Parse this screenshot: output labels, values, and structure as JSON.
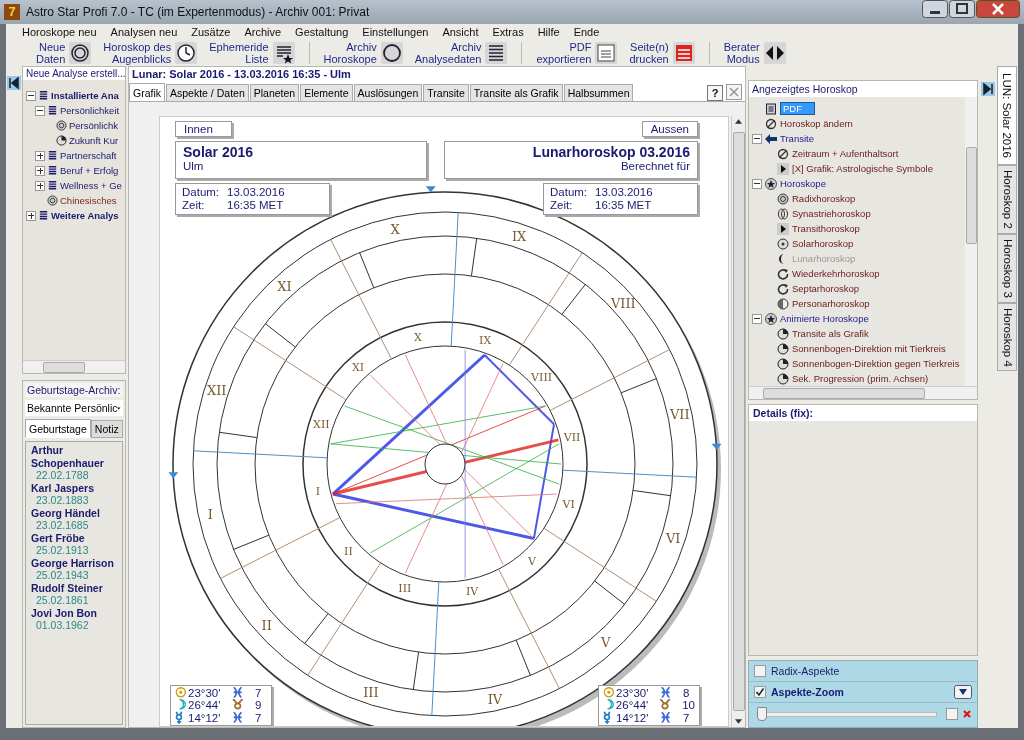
{
  "window": {
    "icon_label": "7",
    "title": "Astro Star Profi 7.0 - TC (im Expertenmodus) - Archiv 001: Privat"
  },
  "menu": [
    "Horoskope neu",
    "Analysen neu",
    "Zusätze",
    "Archive",
    "Gestaltung",
    "Einstellungen",
    "Ansicht",
    "Extras",
    "Hilfe",
    "Ende"
  ],
  "toolbar": [
    [
      {
        "lines": [
          "Neue",
          "Daten"
        ],
        "kind": "rings"
      },
      {
        "lines": [
          "Horoskop des",
          "Augenblicks"
        ],
        "kind": "clock"
      },
      {
        "lines": [
          "Ephemeride",
          "Liste"
        ],
        "kind": "list-star"
      }
    ],
    [
      {
        "lines": [
          "Archiv",
          "Horoskope"
        ],
        "kind": "circle"
      },
      {
        "lines": [
          "Archiv",
          "Analysedaten"
        ],
        "kind": "list"
      }
    ],
    [
      {
        "lines": [
          "PDF",
          "exportieren"
        ],
        "kind": "pdf"
      },
      {
        "lines": [
          "Seite(n)",
          "drucken"
        ],
        "kind": "printer"
      }
    ],
    [
      {
        "lines": [
          "Berater",
          "Modus"
        ],
        "kind": "arrows"
      }
    ]
  ],
  "left_panel": {
    "header": "Neue Analyse erstell...",
    "tree": [
      {
        "label": "Installierte Ana",
        "kind": "stack",
        "expanded": true,
        "children": [
          {
            "label": "Persönlichkeit",
            "kind": "stack",
            "expanded": true,
            "children": [
              {
                "label": "Persönlichk",
                "kind": "wheel"
              },
              {
                "label": "Zukunft Kur",
                "kind": "clock"
              }
            ]
          },
          {
            "label": "Partnerschaft",
            "kind": "stack",
            "expanded": false
          },
          {
            "label": "Beruf + Erfolg",
            "kind": "stack",
            "expanded": false
          },
          {
            "label": "Wellness + Ge",
            "kind": "stack",
            "expanded": false
          },
          {
            "label": "Chinesisches",
            "kind": "chinese"
          }
        ]
      },
      {
        "label": "Weitere Analys",
        "kind": "stack",
        "expanded": false
      }
    ],
    "birthdays": {
      "label": "Geburtstage-Archiv:",
      "dropdown": "Bekannte Persönlic",
      "tabs": [
        {
          "label": "Geburtstage",
          "selected": true
        },
        {
          "label": "Notiz",
          "selected": false
        }
      ],
      "entries": [
        {
          "name": "Arthur Schopenhauer",
          "date": "22.02.1788"
        },
        {
          "name": "Karl Jaspers",
          "date": "23.02.1883"
        },
        {
          "name": "Georg Händel",
          "date": "23.02.1685"
        },
        {
          "name": "Gert Fröbe",
          "date": "25.02.1913"
        },
        {
          "name": "George Harrison",
          "date": "25.02.1943"
        },
        {
          "name": "Rudolf Steiner",
          "date": "25.02.1861"
        },
        {
          "name": "Jovi Jon Bon",
          "date": "01.03.1962"
        }
      ]
    }
  },
  "main": {
    "header": "Lunar: Solar  2016 - 13.03.2016 16:35 - Ulm",
    "tabs": [
      {
        "label": "Grafik",
        "selected": true
      },
      {
        "label": "Aspekte / Daten",
        "selected": false
      },
      {
        "label": "Planeten",
        "selected": false
      },
      {
        "label": "Elemente",
        "selected": false
      },
      {
        "label": "Auslösungen",
        "selected": false
      },
      {
        "label": "Transite",
        "selected": false
      },
      {
        "label": "Transite als Grafik",
        "selected": false
      },
      {
        "label": "Halbsummen",
        "selected": false
      }
    ],
    "help_button": "?",
    "chart": {
      "inner_label": "Innen",
      "outer_label": "Aussen",
      "left_title": "Solar  2016",
      "left_subtitle": "Ulm",
      "right_title": "Lunarhoroskop 03.2016",
      "right_subtitle": "Berechnet für",
      "left_details": [
        {
          "label": "Datum:",
          "value": "13.03.2016"
        },
        {
          "label": "Zeit:",
          "value": "16:35  MET"
        }
      ],
      "right_details": [
        {
          "label": "Datum:",
          "value": "13.03.2016"
        },
        {
          "label": "Zeit:",
          "value": "16:35  MET"
        }
      ],
      "outer_houses": [
        "I",
        "II",
        "III",
        "IV",
        "V",
        "VI",
        "VII",
        "VIII",
        "IX",
        "X",
        "XI",
        "XII"
      ],
      "inner_houses": [
        "I",
        "II",
        "III",
        "IV",
        "V",
        "VI",
        "VII",
        "VIII",
        "IX",
        "X",
        "XI",
        "XII"
      ],
      "left_positions": [
        {
          "planet": {
            "glyph": "☉",
            "color": "#d4a017"
          },
          "position": "23°30'",
          "sign": {
            "glyph": "♓",
            "color": "#3a6ad4"
          },
          "house": "7"
        },
        {
          "planet": {
            "glyph": "☽",
            "color": "#20b0c0"
          },
          "position": "26°44'",
          "sign": {
            "glyph": "♉",
            "color": "#a07030"
          },
          "house": "9"
        },
        {
          "planet": {
            "glyph": "☿",
            "color": "#2080c0"
          },
          "position": "14°12'",
          "sign": {
            "glyph": "♓",
            "color": "#3a6ad4"
          },
          "house": "7"
        }
      ],
      "right_positions": [
        {
          "planet": {
            "glyph": "☉",
            "color": "#d4a017"
          },
          "position": "23°30'",
          "sign": {
            "glyph": "♓",
            "color": "#3a6ad4"
          },
          "house": "8"
        },
        {
          "planet": {
            "glyph": "☽",
            "color": "#20b0c0"
          },
          "position": "26°44'",
          "sign": {
            "glyph": "♉",
            "color": "#a07030"
          },
          "house": "10"
        },
        {
          "planet": {
            "glyph": "☿",
            "color": "#2080c0"
          },
          "position": "14°12'",
          "sign": {
            "glyph": "♓",
            "color": "#3a6ad4"
          },
          "house": "7"
        }
      ]
    }
  },
  "right_panel": {
    "header": "Angezeigtes Horoskop",
    "tree": [
      {
        "label": "PDF",
        "kind": "doc",
        "selected": true,
        "disabled": false
      },
      {
        "label": "Horoskop ändern",
        "kind": "slash",
        "selected": false,
        "disabled": false
      },
      {
        "label": "Transite",
        "kind": "arrow",
        "expanded": true,
        "children": [
          {
            "label": "Zeitraum + Aufenthaltsort",
            "kind": "slash",
            "selected": false,
            "disabled": false
          },
          {
            "label": "[X] Grafik: Astrologische Symbole",
            "kind": "play",
            "selected": false,
            "disabled": false
          }
        ]
      },
      {
        "label": "Horoskope",
        "kind": "star",
        "expanded": true,
        "children": [
          {
            "label": "Radixhoroskop",
            "kind": "wheel",
            "selected": false,
            "disabled": false
          },
          {
            "label": "Synastriehoroskop",
            "kind": "double",
            "selected": false,
            "disabled": false
          },
          {
            "label": "Transithoroskop",
            "kind": "play",
            "selected": false,
            "disabled": false
          },
          {
            "label": "Solarhoroskop",
            "kind": "dot",
            "selected": false,
            "disabled": false
          },
          {
            "label": "Lunarhoroskop",
            "kind": "moon",
            "selected": false,
            "disabled": true
          },
          {
            "label": "Wiederkehrhoroskop",
            "kind": "cycle",
            "selected": false,
            "disabled": false
          },
          {
            "label": "Septarhoroskop",
            "kind": "cycle",
            "selected": false,
            "disabled": false
          },
          {
            "label": "Personarhoroskop",
            "kind": "half",
            "selected": false,
            "disabled": false
          }
        ]
      },
      {
        "label": "Animierte Horoskope",
        "kind": "star",
        "expanded": true,
        "children": [
          {
            "label": "Transite als Grafik",
            "kind": "clock",
            "selected": false,
            "disabled": false
          },
          {
            "label": "Sonnenbogen-Direktion mit Tierkreis",
            "kind": "clock",
            "selected": false,
            "disabled": false
          },
          {
            "label": "Sonnenbogen-Direktion gegen Tierkreis",
            "kind": "clock",
            "selected": false,
            "disabled": false
          },
          {
            "label": "Sek. Progression (prim. Achsen)",
            "kind": "clock",
            "selected": false,
            "disabled": false
          }
        ]
      }
    ],
    "details_label": "Details (fix):",
    "options": [
      {
        "label": "Radix-Aspekte",
        "checked": false
      },
      {
        "label": "Aspekte-Zoom",
        "checked": true
      }
    ],
    "zoom_slider": {
      "level": 0
    },
    "zoom_lock_checked": false
  },
  "side_tabs": [
    {
      "label": "LUN: Solar  2016",
      "selected": true
    },
    {
      "label": "Horoskop 2",
      "selected": false
    },
    {
      "label": "Horoskop 3",
      "selected": false
    },
    {
      "label": "Horoskop 4",
      "selected": false
    }
  ]
}
